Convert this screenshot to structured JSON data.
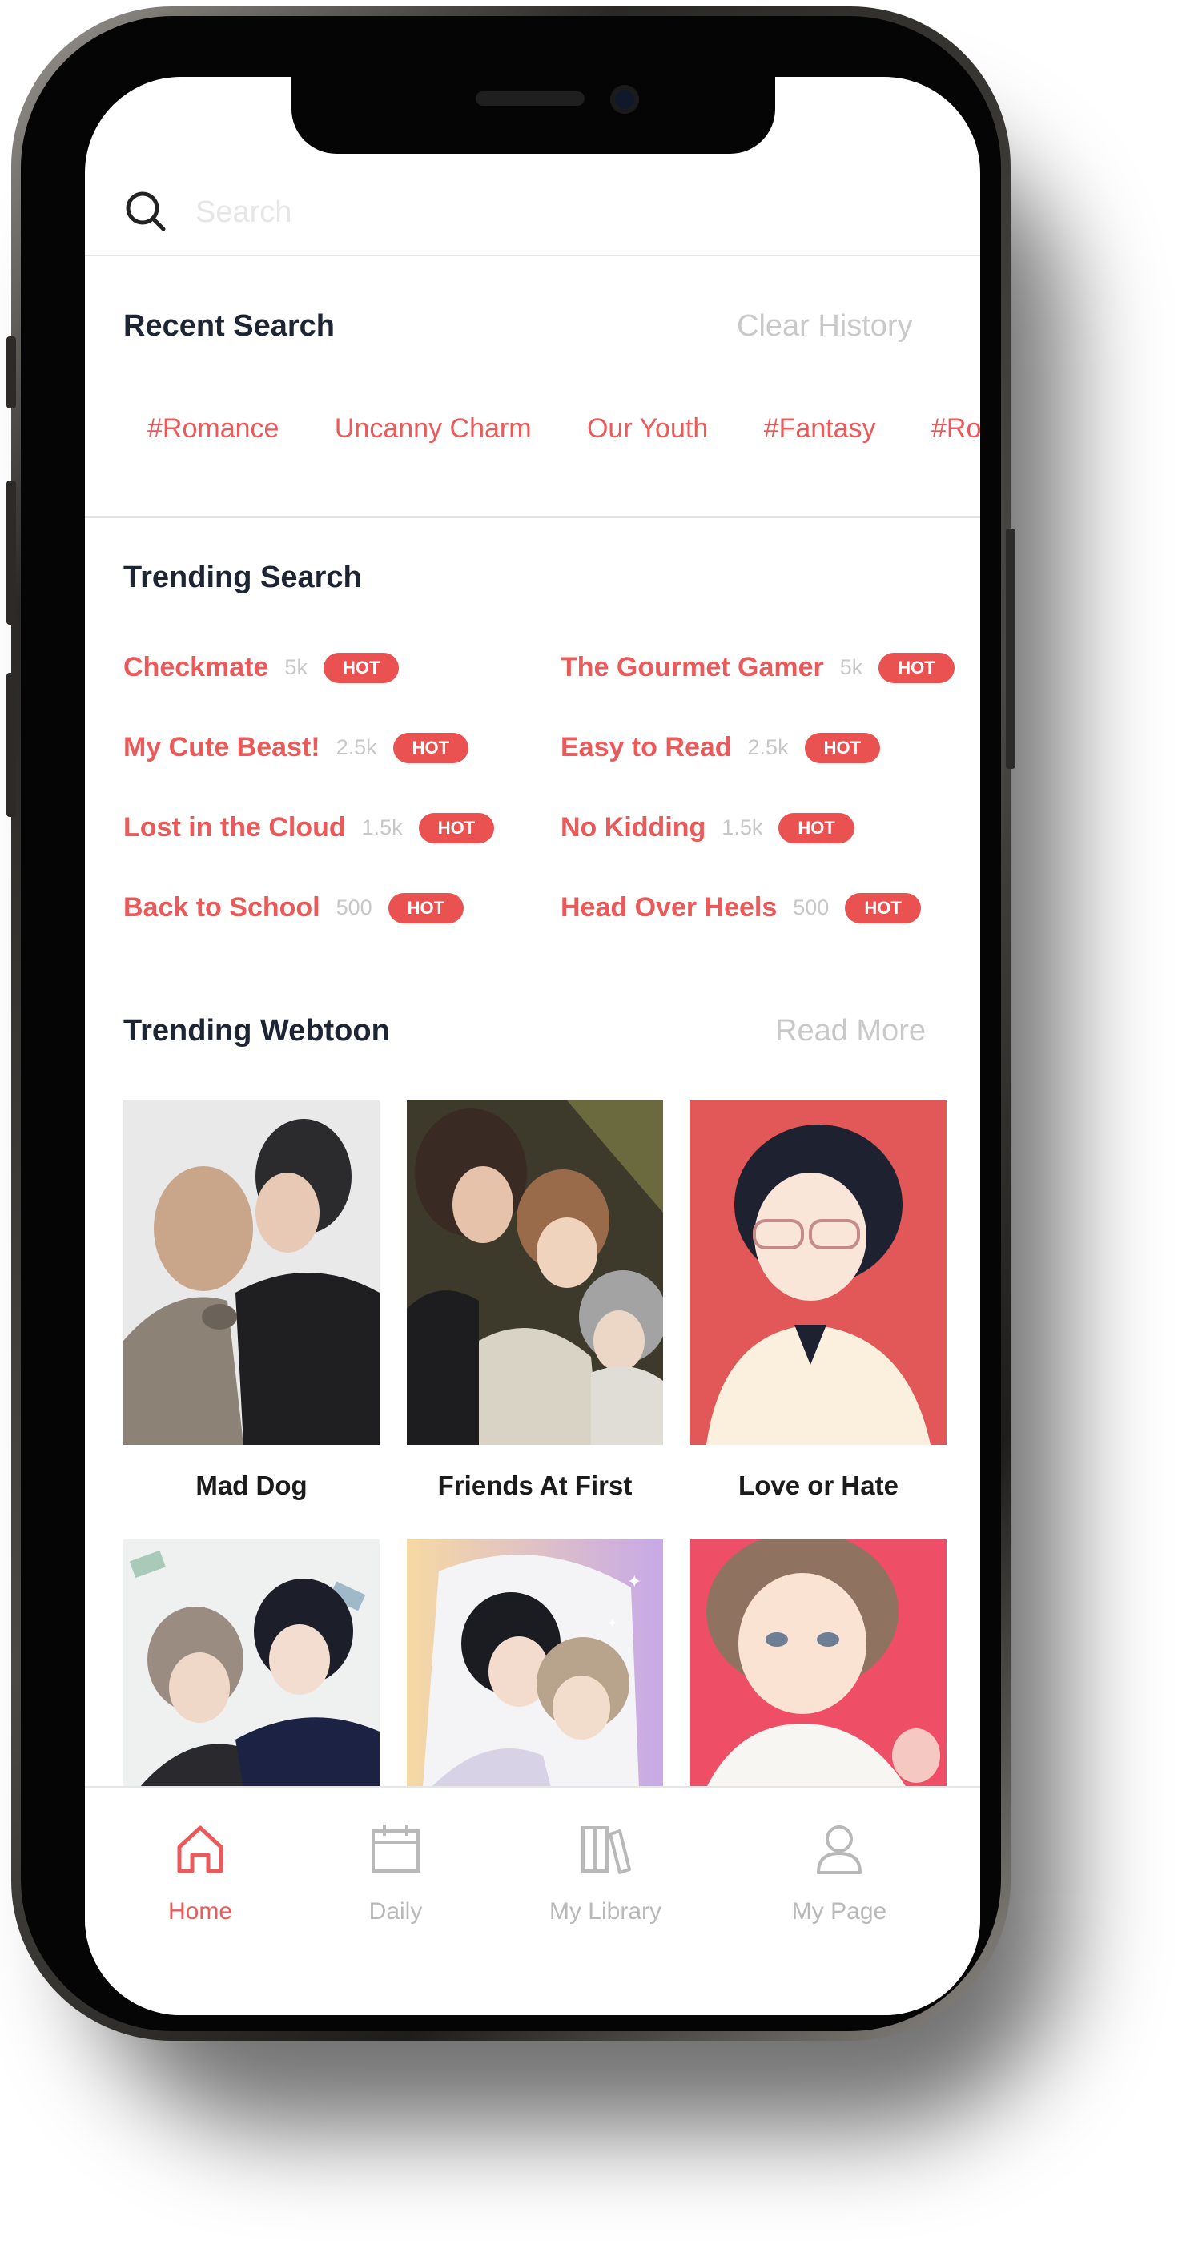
{
  "search": {
    "placeholder": "Search"
  },
  "recent": {
    "title": "Recent Search",
    "clear_label": "Clear History",
    "tags": [
      "#Romance",
      "Uncanny Charm",
      "Our Youth",
      "#Fantasy",
      "#Romance"
    ]
  },
  "trending_search": {
    "title": "Trending Search",
    "hot_label": "HOT",
    "items": [
      {
        "title": "Checkmate",
        "count": "5k"
      },
      {
        "title": "The Gourmet Gamer",
        "count": "5k"
      },
      {
        "title": "My Cute Beast!",
        "count": "2.5k"
      },
      {
        "title": "Easy to Read",
        "count": "2.5k"
      },
      {
        "title": "Lost in the Cloud",
        "count": "1.5k"
      },
      {
        "title": "No Kidding",
        "count": "1.5k"
      },
      {
        "title": "Back to School",
        "count": "500"
      },
      {
        "title": "Head Over Heels",
        "count": "500"
      }
    ]
  },
  "trending_webtoon": {
    "title": "Trending Webtoon",
    "read_more_label": "Read More",
    "items": [
      {
        "title": "Mad Dog"
      },
      {
        "title": "Friends At First"
      },
      {
        "title": "Love or Hate"
      }
    ]
  },
  "nav": {
    "items": [
      {
        "label": "Home",
        "icon": "home-icon",
        "active": true
      },
      {
        "label": "Daily",
        "icon": "calendar-icon",
        "active": false
      },
      {
        "label": "My Library",
        "icon": "library-icon",
        "active": false
      },
      {
        "label": "My Page",
        "icon": "user-icon",
        "active": false
      }
    ]
  },
  "colors": {
    "accent": "#ea5a5a",
    "hot_badge": "#ea5151",
    "heading": "#1d2433",
    "muted": "#c9c9c9"
  }
}
